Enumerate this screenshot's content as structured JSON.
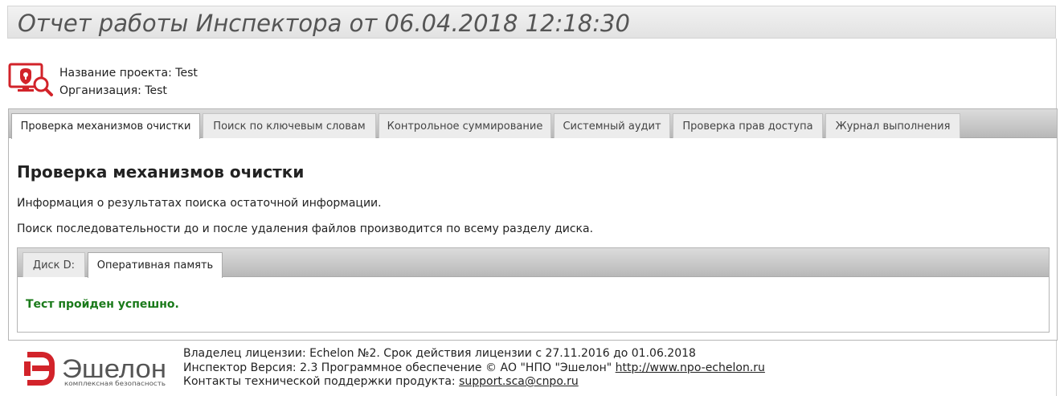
{
  "header": {
    "title": "Отчет работы Инспектора от 06.04.2018 12:18:30"
  },
  "project": {
    "name_label": "Название проекта:",
    "name_value": "Test",
    "org_label": "Организация:",
    "org_value": "Test"
  },
  "tabs": [
    {
      "label": "Проверка механизмов очистки",
      "active": true
    },
    {
      "label": "Поиск по ключевым словам",
      "active": false
    },
    {
      "label": "Контрольное суммирование",
      "active": false
    },
    {
      "label": "Системный аудит",
      "active": false
    },
    {
      "label": "Проверка прав доступа",
      "active": false
    },
    {
      "label": "Журнал выполнения",
      "active": false
    }
  ],
  "content": {
    "heading": "Проверка механизмов очистки",
    "info": "Информация о результатах поиска остаточной информации.",
    "search_note": "Поиск последовательности до и после удаления файлов производится по всему разделу диска."
  },
  "subtabs": [
    {
      "label": "Диск D:",
      "active": false
    },
    {
      "label": "Оперативная память",
      "active": true
    }
  ],
  "result": {
    "text": "Тест пройден успешно."
  },
  "brand": {
    "name": "Эшелон",
    "tagline": "комплексная безопасность"
  },
  "footer": {
    "license": "Владелец лицензии: Echelon №2. Срок действия лицензии с 27.11.2016 до 01.06.2018",
    "version_text": "Инспектор Версия: 2.3 Программное обеспечение © АО \"НПО \"Эшелон\"",
    "website": "http://www.npo-echelon.ru",
    "support_label": "Контакты технической поддержки продукта:",
    "support_email": "support.sca@cnpo.ru"
  },
  "colors": {
    "brand_red": "#d2232a",
    "success_green": "#1a7a1a",
    "tab_bar": "#c8c8c8"
  },
  "icons": {
    "inspector": "monitor-lock-magnifier-icon",
    "brand": "echelon-logo"
  }
}
